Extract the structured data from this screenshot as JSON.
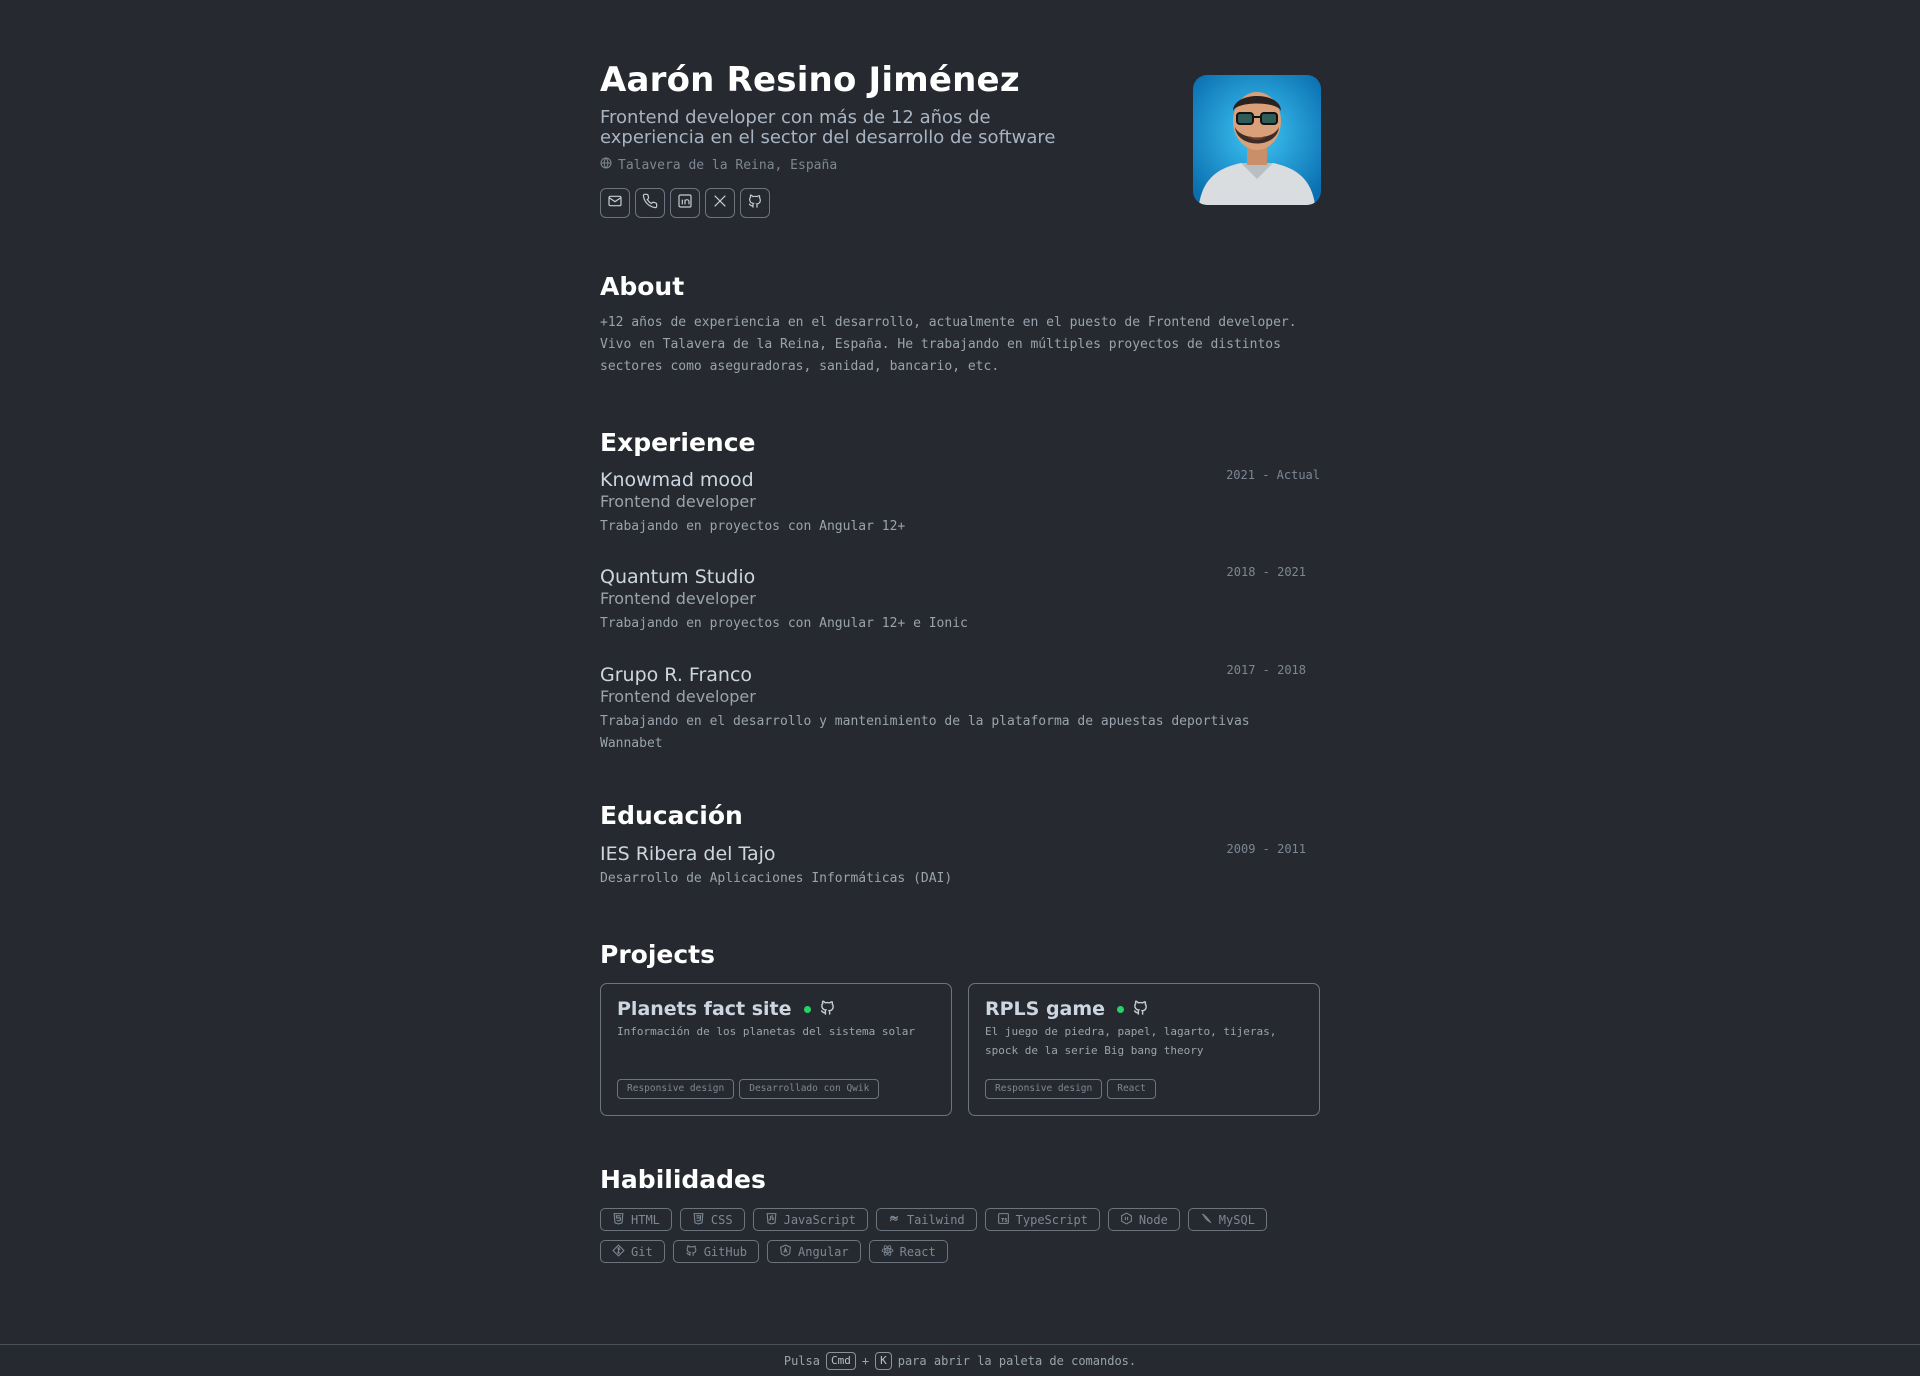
{
  "header": {
    "name": "Aarón Resino Jiménez",
    "tagline": "Frontend developer con más de 12 años de experiencia en el sector del desarrollo de software",
    "location": "Talavera de la Reina, España",
    "socials": [
      "mail-icon",
      "phone-icon",
      "linkedin-icon",
      "x-icon",
      "github-icon"
    ]
  },
  "about": {
    "title": "About",
    "text": "+12 años de experiencia en el desarrollo, actualmente en el puesto de Frontend developer. Vivo en Talavera de la Reina, España. He trabajando en múltiples proyectos de distintos sectores como aseguradoras, sanidad, bancario, etc."
  },
  "experience": {
    "title": "Experience",
    "jobs": [
      {
        "company": "Knowmad mood",
        "role": "Frontend developer",
        "desc": "Trabajando en proyectos con Angular 12+",
        "date": "2021 - Actual"
      },
      {
        "company": "Quantum Studio",
        "role": "Frontend developer",
        "desc": "Trabajando en proyectos con Angular 12+ e Ionic",
        "date": "2018 - 2021"
      },
      {
        "company": "Grupo R. Franco",
        "role": "Frontend developer",
        "desc": "Trabajando en el desarrollo y mantenimiento de la plataforma de apuestas deportivas Wannabet",
        "date": "2017 - 2018"
      }
    ]
  },
  "education": {
    "title": "Educación",
    "items": [
      {
        "school": "IES Ribera del Tajo",
        "degree": "Desarrollo de Aplicaciones Informáticas (DAI)",
        "date": "2009 - 2011"
      }
    ]
  },
  "projects": {
    "title": "Projects",
    "items": [
      {
        "name": "Planets fact site",
        "desc": "Información de los planetas del sistema solar",
        "tags": [
          "Responsive design",
          "Desarrollado con Qwik"
        ]
      },
      {
        "name": "RPLS game",
        "desc": "El juego de piedra, papel, lagarto, tijeras, spock de la serie Big bang theory",
        "tags": [
          "Responsive design",
          "React"
        ]
      }
    ]
  },
  "skills": {
    "title": "Habilidades",
    "items": [
      {
        "label": "HTML",
        "icon": "html5-icon"
      },
      {
        "label": "CSS",
        "icon": "css3-icon"
      },
      {
        "label": "JavaScript",
        "icon": "javascript-icon"
      },
      {
        "label": "Tailwind",
        "icon": "tailwind-icon"
      },
      {
        "label": "TypeScript",
        "icon": "typescript-icon"
      },
      {
        "label": "Node",
        "icon": "node-icon"
      },
      {
        "label": "MySQL",
        "icon": "mysql-icon"
      },
      {
        "label": "Git",
        "icon": "git-icon"
      },
      {
        "label": "GitHub",
        "icon": "github-icon"
      },
      {
        "label": "Angular",
        "icon": "angular-icon"
      },
      {
        "label": "React",
        "icon": "react-icon"
      }
    ]
  },
  "footer": {
    "prefix": "Pulsa",
    "key1": "Cmd",
    "plus": "+",
    "key2": "K",
    "suffix": "para abrir la paleta de comandos."
  },
  "colors": {
    "background": "#262a30",
    "accent_dot": "#25d366",
    "border": "#6c7480"
  }
}
